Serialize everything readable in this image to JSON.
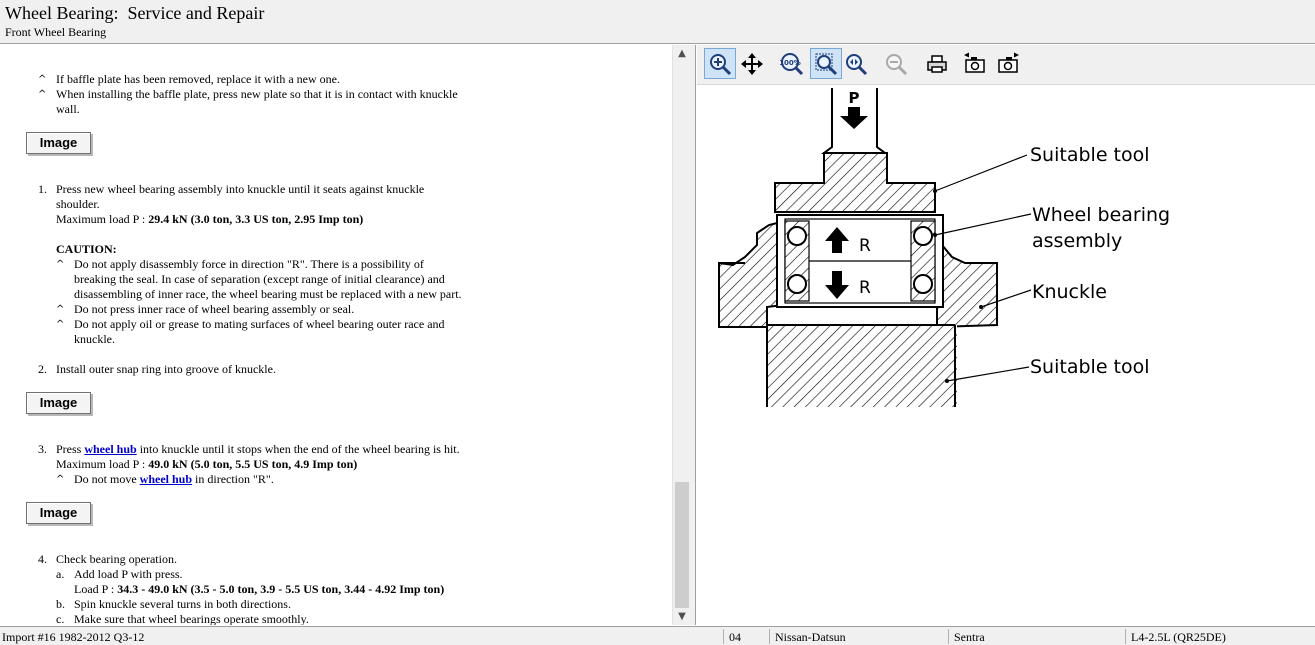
{
  "header": {
    "title": "Wheel Bearing:  Service and Repair",
    "subtitle": "Front Wheel Bearing"
  },
  "content": {
    "intro_bullets": [
      "If baffle plate has been removed, replace it with a new one.",
      "When installing the baffle plate, press new plate so that it is in contact with knuckle",
      "wall."
    ],
    "image_button_label": "Image",
    "step1": {
      "num": "1.",
      "text_lines": [
        "Press new wheel bearing assembly into knuckle until it seats against knuckle",
        "shoulder."
      ],
      "load_label": "Maximum load P : ",
      "load_value": "29.4 kN (3.0 ton, 3.3 US ton, 2.95 Imp ton)",
      "caution_title": "CAUTION:",
      "caution_lines": [
        "Do not apply disassembly force in direction \"R\". There is a possibility of",
        "breaking the seal. In case of separation (except range of initial clearance) and",
        "disassembling of inner race, the wheel bearing must be replaced with a new part.",
        "Do not press inner race of wheel bearing assembly or seal.",
        "Do not apply oil or grease to mating surfaces of wheel bearing outer race and",
        "knuckle."
      ]
    },
    "step2": {
      "num": "2.",
      "text": "Install outer snap ring into groove of knuckle."
    },
    "step3": {
      "num": "3.",
      "text_before": "Press ",
      "link": "wheel hub",
      "text_after": " into knuckle until it stops when the end of the wheel bearing is hit.",
      "load_label": "Maximum load P : ",
      "load_value": "49.0 kN (5.0 ton, 5.5 US ton, 4.9 Imp ton)",
      "sub_before": "Do not move ",
      "sub_link": "wheel hub",
      "sub_after": " in direction \"R\"."
    },
    "step4": {
      "num": "4.",
      "text": "Check bearing operation.",
      "a_label": "a.",
      "a_text": "Add load P with press.",
      "a_load_label": "Load P : ",
      "a_load_value": "34.3 - 49.0 kN (3.5 - 5.0 ton, 3.9 - 5.5 US ton, 3.44 - 4.92 Imp ton)",
      "b_label": "b.",
      "b_text": "Spin knuckle several turns in both directions.",
      "c_label": "c.",
      "c_text": "Make sure that wheel bearings operate smoothly."
    },
    "caret": "^"
  },
  "toolbar": {
    "tools": [
      {
        "icon": "zoom-in-icon",
        "active": true
      },
      {
        "icon": "pan-icon",
        "active": false
      },
      {
        "icon": "zoom-100-icon",
        "active": false
      },
      {
        "icon": "zoom-fit-icon",
        "active": true
      },
      {
        "icon": "zoom-window-icon",
        "active": false
      },
      {
        "icon": "zoom-out-icon",
        "active": false
      },
      {
        "icon": "print-icon",
        "active": false
      },
      {
        "icon": "previous-image-icon",
        "active": false
      },
      {
        "icon": "next-image-icon",
        "active": false
      }
    ],
    "zoom_100_text": "100%"
  },
  "diagram": {
    "labels": {
      "press": "P",
      "tool_top": "Suitable tool",
      "bearing_line1": "Wheel bearing",
      "bearing_line2": "assembly",
      "knuckle": "Knuckle",
      "tool_bottom": "Suitable tool",
      "r_upper": "R",
      "r_lower": "R"
    }
  },
  "status": {
    "source": "Import #16 1982-2012 Q3-12",
    "code": "04",
    "make": "Nissan-Datsun",
    "model": "Sentra",
    "engine": "L4-2.5L (QR25DE)"
  },
  "colors": {
    "chrome": "#f0f0f0",
    "link": "#0000cc",
    "active_tool": "#cfe3f7"
  }
}
